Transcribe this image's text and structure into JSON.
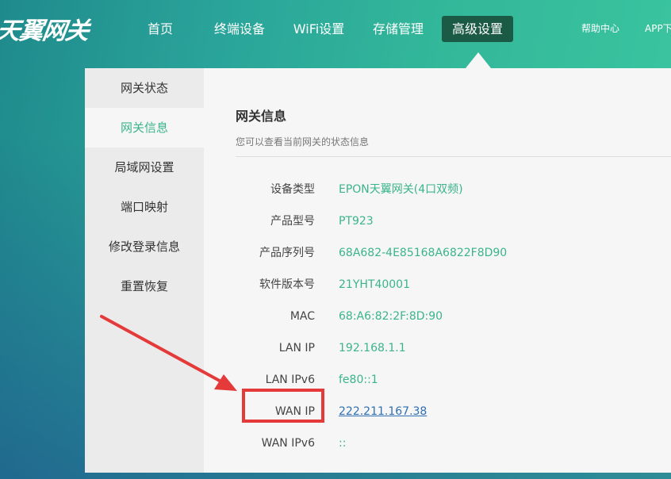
{
  "brand": {
    "logo_text": "天翼网关"
  },
  "nav": {
    "items": [
      {
        "label": "首页"
      },
      {
        "label": "终端设备"
      },
      {
        "label": "WiFi设置"
      },
      {
        "label": "存储管理"
      },
      {
        "label": "高级设置",
        "active": true
      }
    ],
    "help_label": "帮助中心",
    "app_label": "APP下"
  },
  "sidebar": {
    "items": [
      {
        "label": "网关状态"
      },
      {
        "label": "网关信息",
        "active": true
      },
      {
        "label": "局域网设置"
      },
      {
        "label": "端口映射"
      },
      {
        "label": "修改登录信息"
      },
      {
        "label": "重置恢复"
      }
    ]
  },
  "main": {
    "title": "网关信息",
    "description": "您可以查看当前网关的状态信息",
    "rows": [
      {
        "label": "设备类型",
        "value": "EPON天翼网关(4口双频)"
      },
      {
        "label": "产品型号",
        "value": "PT923"
      },
      {
        "label": "产品序列号",
        "value": "68A682-4E85168A6822F8D90"
      },
      {
        "label": "软件版本号",
        "value": "21YHT40001"
      },
      {
        "label": "MAC",
        "value": "68:A6:82:2F:8D:90"
      },
      {
        "label": "LAN IP",
        "value": "192.168.1.1"
      },
      {
        "label": "LAN IPv6",
        "value": "fe80::1"
      },
      {
        "label": "WAN IP",
        "value": "222.211.167.38"
      },
      {
        "label": "WAN IPv6",
        "value": "::"
      }
    ]
  },
  "colors": {
    "accent": "#3ab58a",
    "active_nav": "#1b5a45",
    "annotation": "#e53a3a",
    "link": "#2f6fb2"
  }
}
